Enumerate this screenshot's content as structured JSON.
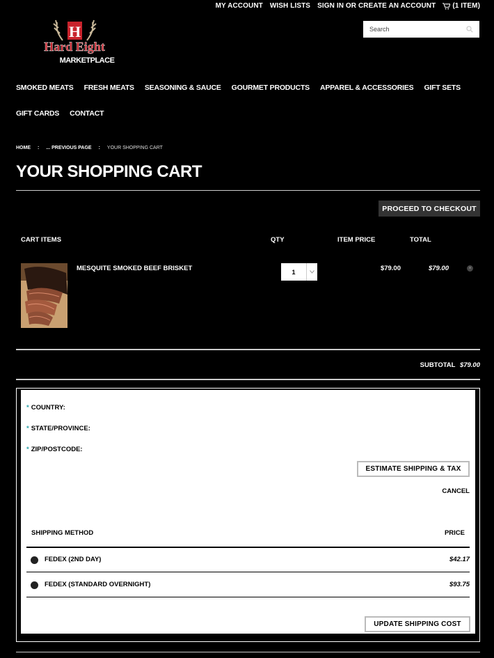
{
  "top_nav": {
    "my_account": "MY ACCOUNT",
    "wish_lists": "WISH LISTS",
    "sign_in": "SIGN IN OR CREATE AN ACCOUNT",
    "cart": "(1 ITEM)"
  },
  "logo": {
    "line1": "Hard Eight",
    "line2": "MARKETPLACE",
    "letter": "H"
  },
  "search": {
    "placeholder": "Search"
  },
  "main_nav": {
    "row1": [
      "SMOKED MEATS",
      "FRESH MEATS",
      "SEASONING & SAUCE",
      "GOURMET PRODUCTS",
      "APPAREL & ACCESSORIES",
      "GIFT SETS"
    ],
    "row2": [
      "GIFT CARDS",
      "CONTACT"
    ]
  },
  "breadcrumb": {
    "home": "HOME",
    "previous": "... PREVIOUS PAGE",
    "current": "YOUR SHOPPING CART",
    "separator": ":"
  },
  "page_title": "YOUR SHOPPING CART",
  "proceed_checkout": "PROCEED TO CHECKOUT",
  "cart_table": {
    "headers": {
      "items": "CART ITEMS",
      "qty": "QTY",
      "item_price": "ITEM PRICE",
      "total": "TOTAL"
    },
    "items": [
      {
        "name": "MESQUITE SMOKED BEEF BRISKET",
        "qty": "1",
        "item_price": "$79.00",
        "total": "$79.00"
      }
    ]
  },
  "subtotal": {
    "label": "SUBTOTAL",
    "amount": "$79.00"
  },
  "shipping": {
    "required_mark": "*",
    "country_label": "COUNTRY:",
    "state_label": "STATE/PROVINCE:",
    "zip_label": "ZIP/POSTCODE:",
    "estimate_button": "ESTIMATE SHIPPING & TAX",
    "cancel": "CANCEL",
    "method_header": "SHIPPING METHOD",
    "price_header": "PRICE",
    "methods": [
      {
        "name": "FEDEX (2ND DAY)",
        "price": "$42.17"
      },
      {
        "name": "FEDEX (STANDARD OVERNIGHT)",
        "price": "$93.75"
      }
    ],
    "update_button": "UPDATE SHIPPING COST"
  },
  "colors": {
    "background": "#000000",
    "accent_required": "#2aa3a9",
    "logo_red": "#c8232c",
    "button_dark": "#333333"
  }
}
